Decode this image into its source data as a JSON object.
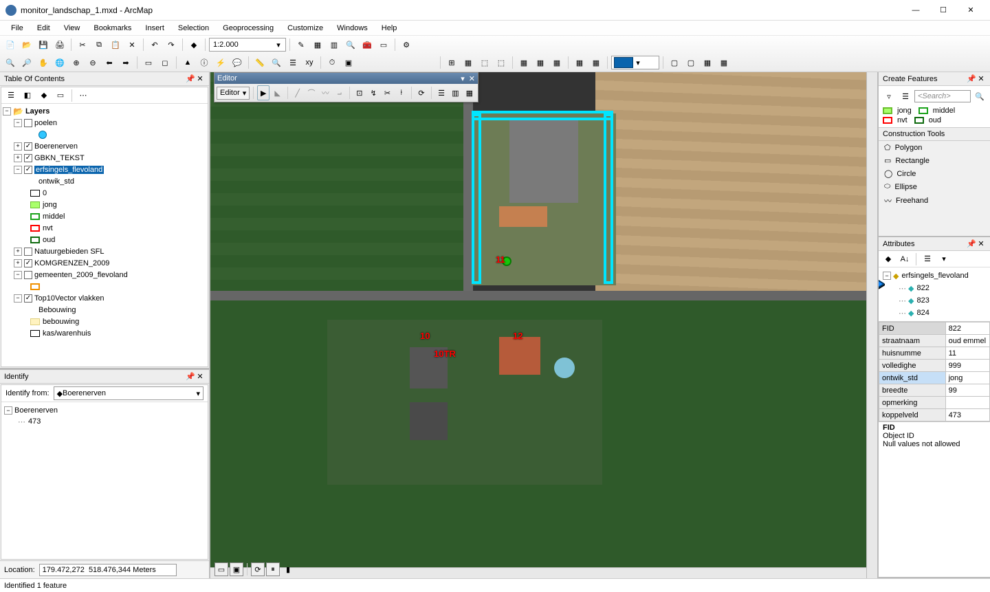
{
  "window": {
    "title": "monitor_landschap_1.mxd - ArcMap"
  },
  "menus": [
    "File",
    "Edit",
    "View",
    "Bookmarks",
    "Insert",
    "Selection",
    "Geoprocessing",
    "Customize",
    "Windows",
    "Help"
  ],
  "scale": "1:2.000",
  "toc": {
    "title": "Table Of Contents",
    "root": "Layers",
    "items": [
      {
        "exp": "-",
        "chk": false,
        "label": "poelen",
        "kind": "layer"
      },
      {
        "sym": "#30c6ff",
        "symshape": "circle",
        "indent": 3
      },
      {
        "exp": "+",
        "chk": true,
        "label": "Boerenerven"
      },
      {
        "exp": "+",
        "chk": true,
        "label": "GBKN_TEKST"
      },
      {
        "exp": "-",
        "chk": true,
        "label": "erfsingels_flevoland",
        "selected": true
      },
      {
        "label": "ontwik_std",
        "indent": 3
      },
      {
        "sym": "#ffffff",
        "border": "#000",
        "label": "0",
        "indent": 2
      },
      {
        "sym": "#a9ff6b",
        "border": "#6abf2e",
        "label": "jong",
        "indent": 2
      },
      {
        "sym": "none",
        "border": "#1aa31a",
        "bw": 2,
        "label": "middel",
        "indent": 2
      },
      {
        "sym": "none",
        "border": "#ff0000",
        "bw": 2,
        "label": "nvt",
        "indent": 2
      },
      {
        "sym": "none",
        "border": "#0e6a0e",
        "bw": 2,
        "label": "oud",
        "indent": 2
      },
      {
        "exp": "+",
        "chk": false,
        "label": "Natuurgebieden SFL"
      },
      {
        "exp": "+",
        "chk": true,
        "label": "KOMGRENZEN_2009"
      },
      {
        "exp": "-",
        "chk": false,
        "label": "gemeenten_2009_flevoland"
      },
      {
        "sym": "none",
        "border": "#f09000",
        "bw": 2,
        "indent": 2
      },
      {
        "exp": "-",
        "chk": true,
        "label": "Top10Vector vlakken"
      },
      {
        "label": "Bebouwing",
        "indent": 3
      },
      {
        "sym": "#fff3c0",
        "border": "#e0d080",
        "label": "bebouwing",
        "indent": 2
      },
      {
        "sym": "#ffffff",
        "border": "#000",
        "label": "kas/warenhuis",
        "indent": 2
      }
    ]
  },
  "identify": {
    "title": "Identify",
    "from_label": "Identify from:",
    "from_value": "Boerenerven",
    "tree_root": "Boerenerven",
    "tree_child": "473"
  },
  "location": {
    "label": "Location:",
    "value": "179.472,272  518.476,344 Meters"
  },
  "status": "Identified 1 feature",
  "editor": {
    "title": "Editor",
    "menu": "Editor"
  },
  "map_labels": {
    "a": "11",
    "b": "10",
    "c": "10TR",
    "d": "12"
  },
  "create_features": {
    "title": "Create Features",
    "search_placeholder": "<Search>",
    "templates": [
      {
        "label": "jong",
        "border": "#6abf2e",
        "fill": "#a9ff6b"
      },
      {
        "label": "middel",
        "border": "#1aa31a",
        "fill": "none"
      },
      {
        "label": "nvt",
        "border": "#ff0000",
        "fill": "none"
      },
      {
        "label": "oud",
        "border": "#0e6a0e",
        "fill": "none"
      }
    ],
    "tools_title": "Construction Tools",
    "tools": [
      "Polygon",
      "Rectangle",
      "Circle",
      "Ellipse",
      "Freehand"
    ]
  },
  "attributes": {
    "title": "Attributes",
    "layer": "erfsingels_flevoland",
    "features": [
      "822",
      "823",
      "824"
    ],
    "grid": [
      {
        "k": "FID",
        "v": "822",
        "hdr": true
      },
      {
        "k": "straatnaam",
        "v": "oud emmel"
      },
      {
        "k": "huisnumme",
        "v": "11"
      },
      {
        "k": "volledighe",
        "v": "999"
      },
      {
        "k": "ontwik_std",
        "v": "jong",
        "sel": true
      },
      {
        "k": "breedte",
        "v": "99"
      },
      {
        "k": "opmerking",
        "v": ""
      },
      {
        "k": "koppelveld",
        "v": "473"
      }
    ],
    "field_name": "FID",
    "field_type": "Object ID",
    "field_null": "Null values not allowed"
  }
}
